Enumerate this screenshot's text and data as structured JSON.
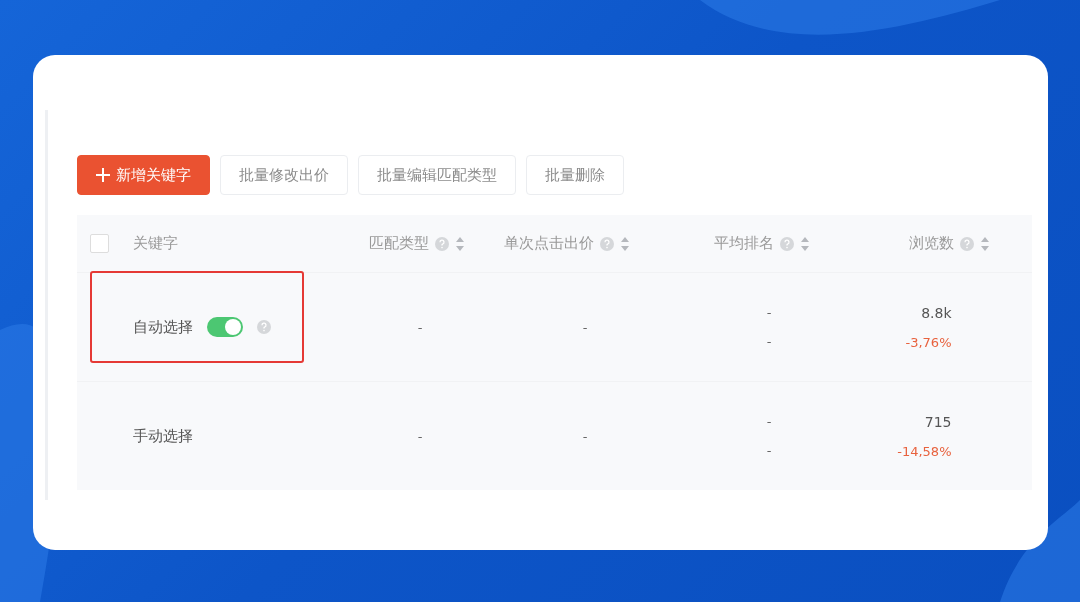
{
  "toolbar": {
    "buttons": [
      {
        "label": "新增关键字",
        "kind": "primary"
      },
      {
        "label": "批量修改出价",
        "kind": "default"
      },
      {
        "label": "批量编辑匹配类型",
        "kind": "default"
      },
      {
        "label": "批量删除",
        "kind": "default"
      }
    ]
  },
  "table": {
    "select_all": {
      "checked": false
    },
    "columns": [
      {
        "label": "关键字",
        "help": false,
        "sortable": false
      },
      {
        "label": "匹配类型",
        "help": true,
        "sortable": true
      },
      {
        "label": "单次点击出价",
        "help": true,
        "sortable": true
      },
      {
        "label": "平均排名",
        "help": true,
        "sortable": true
      },
      {
        "label": "浏览数",
        "help": true,
        "sortable": true
      }
    ],
    "rows": [
      {
        "keyword": "自动选择",
        "highlighted": true,
        "toggle": {
          "on": true
        },
        "match_type": "-",
        "bid": "-",
        "rank": [
          "-",
          "-"
        ],
        "views": "8.8k",
        "views_change": "-3,76%"
      },
      {
        "keyword": "手动选择",
        "highlighted": false,
        "match_type": "-",
        "bid": "-",
        "rank": [
          "-",
          "-"
        ],
        "views": "715",
        "views_change": "-14,58%"
      }
    ]
  }
}
